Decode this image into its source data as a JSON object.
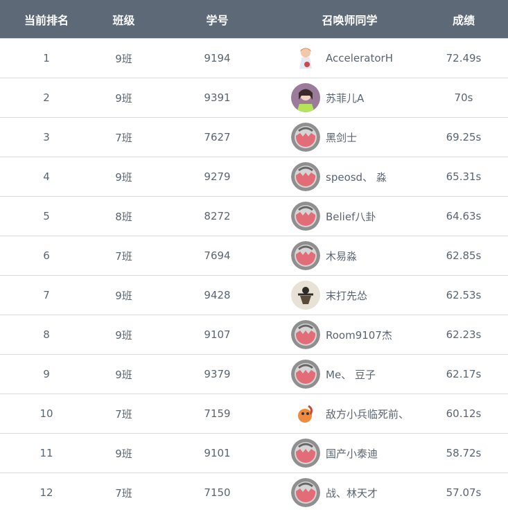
{
  "header": {
    "rank": "当前排名",
    "class": "班级",
    "student_id": "学号",
    "player": "召唤师同学",
    "score": "成绩"
  },
  "rows": [
    {
      "rank": "1",
      "class": "9班",
      "student_id": "9194",
      "name": "AcceleratorH",
      "score": "72.49s",
      "avatar": "anime-girl-avatar"
    },
    {
      "rank": "2",
      "class": "9班",
      "student_id": "9391",
      "name": "苏菲儿A",
      "score": "70s",
      "avatar": "photo-avatar"
    },
    {
      "rank": "3",
      "class": "7班",
      "student_id": "7627",
      "name": "黑剑士",
      "score": "69.25s",
      "avatar": "default-avatar"
    },
    {
      "rank": "4",
      "class": "9班",
      "student_id": "9279",
      "name": "speosd、 淼",
      "score": "65.31s",
      "avatar": "default-avatar"
    },
    {
      "rank": "5",
      "class": "8班",
      "student_id": "8272",
      "name": "Belief八卦",
      "score": "64.63s",
      "avatar": "default-avatar"
    },
    {
      "rank": "6",
      "class": "7班",
      "student_id": "7694",
      "name": "木易淼",
      "score": "62.85s",
      "avatar": "default-avatar"
    },
    {
      "rank": "7",
      "class": "9班",
      "student_id": "9428",
      "name": "末打先怂",
      "score": "62.53s",
      "avatar": "figure-avatar"
    },
    {
      "rank": "8",
      "class": "9班",
      "student_id": "9107",
      "name": "Room9107杰",
      "score": "62.23s",
      "avatar": "default-avatar"
    },
    {
      "rank": "9",
      "class": "9班",
      "student_id": "9379",
      "name": "Me、 豆子",
      "score": "62.17s",
      "avatar": "default-avatar"
    },
    {
      "rank": "10",
      "class": "7班",
      "student_id": "7159",
      "name": "敌方小兵临死前、",
      "score": "60.12s",
      "avatar": "cartoon-avatar"
    },
    {
      "rank": "11",
      "class": "9班",
      "student_id": "9101",
      "name": "国产小泰迪",
      "score": "58.72s",
      "avatar": "default-avatar"
    },
    {
      "rank": "12",
      "class": "7班",
      "student_id": "7150",
      "name": "战、林天才",
      "score": "57.07s",
      "avatar": "default-avatar"
    }
  ],
  "colors": {
    "header_bg": "#5d6977",
    "header_text": "#ffffff",
    "row_text": "#5a6470",
    "divider": "#d9d9d9",
    "default_avatar_ring": "#8f8f8f",
    "default_avatar_pink": "#e26d78"
  }
}
